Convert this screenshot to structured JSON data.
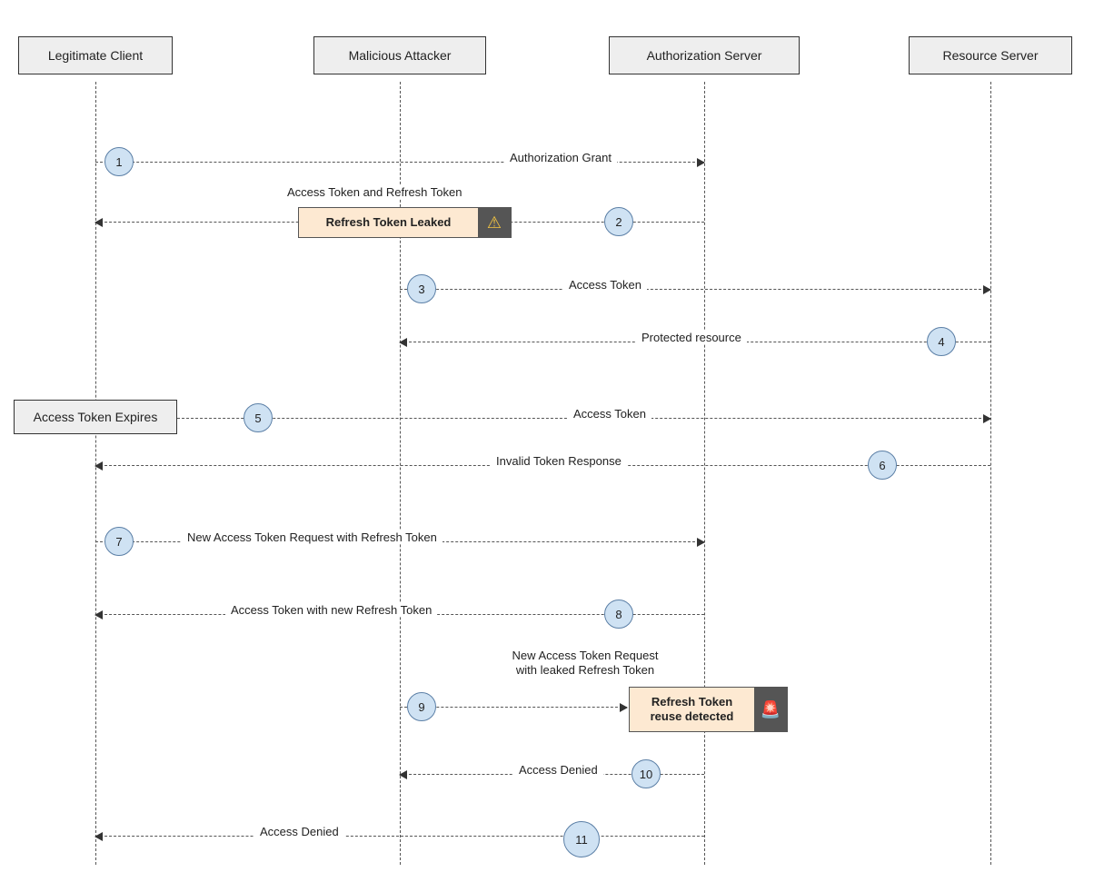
{
  "actors": {
    "client": "Legitimate Client",
    "attacker": "Malicious Attacker",
    "auth": "Authorization Server",
    "resource": "Resource Server"
  },
  "state": {
    "token_expires": "Access Token Expires"
  },
  "notes": {
    "leaked": "Refresh Token Leaked",
    "reuse": "Refresh Token reuse detected"
  },
  "icons": {
    "warning": "⚠",
    "alarm": "🚨"
  },
  "steps": {
    "s1": "1",
    "s2": "2",
    "s3": "3",
    "s4": "4",
    "s5": "5",
    "s6": "6",
    "s7": "7",
    "s8": "8",
    "s9": "9",
    "s10": "10",
    "s11": "11"
  },
  "messages": {
    "m1": "Authorization Grant",
    "m2a": "Access Token  and Refresh Token",
    "m3": "Access Token",
    "m4": "Protected resource",
    "m5": "Access Token",
    "m6": "Invalid Token Response",
    "m7": "New Access Token Request with Refresh Token",
    "m8": "Access Token with new Refresh Token",
    "m9a": "New Access Token Request",
    "m9b": "with leaked Refresh Token",
    "m10": "Access Denied",
    "m11": "Access Denied"
  }
}
